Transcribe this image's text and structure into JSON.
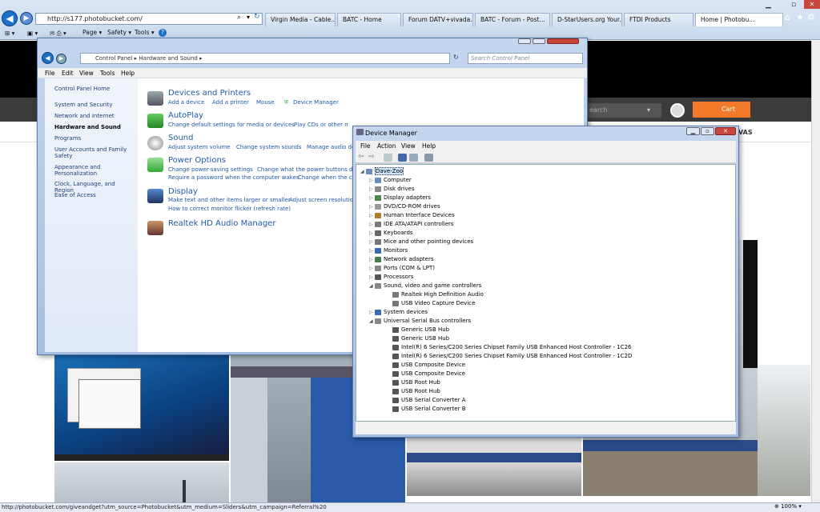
{
  "browser": {
    "url": "http://s177.photobucket.com/",
    "tabs": [
      {
        "label": "Virgin Media - Cable...",
        "active": false
      },
      {
        "label": "BATC - Home",
        "active": false
      },
      {
        "label": "Forum DATV+vivada...",
        "active": false
      },
      {
        "label": "BATC - Forum - Post...",
        "active": false
      },
      {
        "label": "D-StarUsers.org Your...",
        "active": false
      },
      {
        "label": "FTDI Products",
        "active": false
      },
      {
        "label": "Home | Photobu...",
        "active": true
      }
    ],
    "command_bar": {
      "page": "Page ▾",
      "safety": "Safety ▾",
      "tools": "Tools ▾",
      "help": "?"
    },
    "status_url": "http://photobucket.com/giveandget?utm_source=Photobucket&utm_medium=Sliders&utm_campaign=Referral%20",
    "zoom": "100%"
  },
  "photobucket": {
    "search_placeholder": "earch",
    "cart": "Cart",
    "nav_fragment": "VAS"
  },
  "control_panel": {
    "breadcrumb": [
      "Control Panel",
      "Hardware and Sound"
    ],
    "search_placeholder": "Search Control Panel",
    "menu": [
      "File",
      "Edit",
      "View",
      "Tools",
      "Help"
    ],
    "left": [
      "Control Panel Home",
      "System and Security",
      "Network and Internet",
      "Hardware and Sound",
      "Programs",
      "User Accounts and Family Safety",
      "Appearance and Personalization",
      "Clock, Language, and Region",
      "Ease of Access"
    ],
    "categories": [
      {
        "title": "Devices and Printers",
        "links": [
          "Add a device",
          "Add a printer",
          "Mouse",
          "Device Manager"
        ]
      },
      {
        "title": "AutoPlay",
        "links": [
          "Change default settings for media or devices",
          "Play CDs or other media automatically"
        ]
      },
      {
        "title": "Sound",
        "links": [
          "Adjust system volume",
          "Change system sounds",
          "Manage audio de"
        ]
      },
      {
        "title": "Power Options",
        "links": [
          "Change power-saving settings",
          "Change what the power buttons do",
          "Require a password when the computer wakes",
          "Change when the c"
        ]
      },
      {
        "title": "Display",
        "links": [
          "Make text and other items larger or smaller",
          "Adjust screen resolution",
          "How to correct monitor flicker (refresh rate)"
        ]
      },
      {
        "title": "Realtek HD Audio Manager",
        "links": []
      }
    ]
  },
  "device_manager": {
    "title": "Device Manager",
    "menu": [
      "File",
      "Action",
      "View",
      "Help"
    ],
    "root": "Dave-Zoo",
    "nodes": [
      {
        "label": "Computer",
        "level": 1,
        "expander": "▷",
        "color": "#6a8cc0"
      },
      {
        "label": "Disk drives",
        "level": 1,
        "expander": "▷",
        "color": "#888"
      },
      {
        "label": "Display adapters",
        "level": 1,
        "expander": "▷",
        "color": "#4a8a4a"
      },
      {
        "label": "DVD/CD-ROM drives",
        "level": 1,
        "expander": "▷",
        "color": "#999"
      },
      {
        "label": "Human Interface Devices",
        "level": 1,
        "expander": "▷",
        "color": "#b07a30"
      },
      {
        "label": "IDE ATA/ATAPI controllers",
        "level": 1,
        "expander": "▷",
        "color": "#7a7a7a"
      },
      {
        "label": "Keyboards",
        "level": 1,
        "expander": "▷",
        "color": "#666"
      },
      {
        "label": "Mice and other pointing devices",
        "level": 1,
        "expander": "▷",
        "color": "#777"
      },
      {
        "label": "Monitors",
        "level": 1,
        "expander": "▷",
        "color": "#3a6ab0"
      },
      {
        "label": "Network adapters",
        "level": 1,
        "expander": "▷",
        "color": "#4a7a4a"
      },
      {
        "label": "Ports (COM & LPT)",
        "level": 1,
        "expander": "▷",
        "color": "#888"
      },
      {
        "label": "Processors",
        "level": 1,
        "expander": "▷",
        "color": "#555"
      },
      {
        "label": "Sound, video and game controllers",
        "level": 1,
        "expander": "◢",
        "color": "#888"
      },
      {
        "label": "Realtek High Definition Audio",
        "level": 2,
        "expander": "",
        "color": "#777"
      },
      {
        "label": "USB Video Capture Device",
        "level": 2,
        "expander": "",
        "color": "#777"
      },
      {
        "label": "System devices",
        "level": 1,
        "expander": "▷",
        "color": "#3a6ab0"
      },
      {
        "label": "Universal Serial Bus controllers",
        "level": 1,
        "expander": "◢",
        "color": "#888"
      },
      {
        "label": "Generic USB Hub",
        "level": 2,
        "expander": "",
        "color": "#555"
      },
      {
        "label": "Generic USB Hub",
        "level": 2,
        "expander": "",
        "color": "#555"
      },
      {
        "label": "Intel(R) 6 Series/C200 Series Chipset Family USB Enhanced Host Controller - 1C26",
        "level": 2,
        "expander": "",
        "color": "#555"
      },
      {
        "label": "Intel(R) 6 Series/C200 Series Chipset Family USB Enhanced Host Controller - 1C2D",
        "level": 2,
        "expander": "",
        "color": "#555"
      },
      {
        "label": "USB Composite Device",
        "level": 2,
        "expander": "",
        "color": "#555"
      },
      {
        "label": "USB Composite Device",
        "level": 2,
        "expander": "",
        "color": "#555"
      },
      {
        "label": "USB Root Hub",
        "level": 2,
        "expander": "",
        "color": "#555"
      },
      {
        "label": "USB Root Hub",
        "level": 2,
        "expander": "",
        "color": "#555"
      },
      {
        "label": "USB Serial Converter A",
        "level": 2,
        "expander": "",
        "color": "#555"
      },
      {
        "label": "USB Serial Converter B",
        "level": 2,
        "expander": "",
        "color": "#555"
      }
    ]
  },
  "colors": {
    "accent_orange": "#f27a2a",
    "link_blue": "#1e5aa8",
    "category_green": "#1a5c1a"
  }
}
